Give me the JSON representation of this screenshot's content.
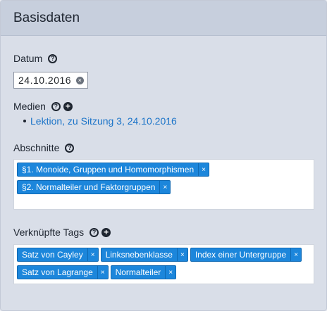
{
  "header": {
    "title": "Basisdaten"
  },
  "datum": {
    "label": "Datum",
    "value": "24.10.2016"
  },
  "medien": {
    "label": "Medien",
    "items": [
      "Lektion, zu Sitzung 3, 24.10.2016"
    ]
  },
  "abschnitte": {
    "label": "Abschnitte",
    "tags": [
      "§1. Monoide, Gruppen und Homomorphismen",
      "§2. Normalteiler und Faktorgruppen"
    ]
  },
  "tags": {
    "label": "Verknüpfte Tags",
    "items": [
      "Satz von Cayley",
      "Linksnebenklasse",
      "Index einer Untergruppe",
      "Satz von Lagrange",
      "Normalteiler"
    ]
  },
  "icons": {
    "help": "question-circle-icon",
    "add": "plus-circle-icon",
    "clear": "clear-circle-icon",
    "remove": "x-icon"
  },
  "colors": {
    "accent": "#1c86db",
    "link": "#1a73c8",
    "panel": "#d9dee8"
  }
}
